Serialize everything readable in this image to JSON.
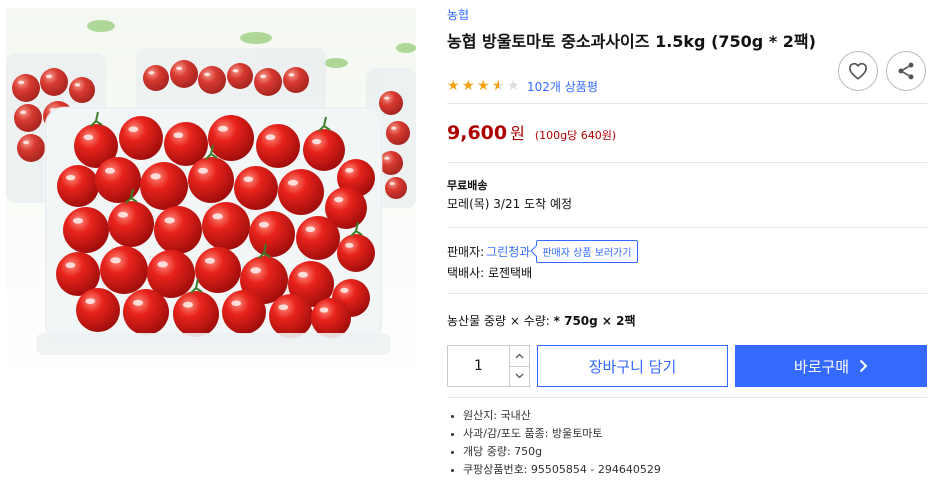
{
  "product": {
    "brand": "농협",
    "title": "농협 방울토마토 중소과사이즈 1.5kg (750g * 2팩)",
    "rating": 3.5,
    "review_count": "102개 상품평",
    "image_icon": "cherry-tomatoes-photo"
  },
  "price": {
    "amount": "9,600",
    "currency": "원",
    "unit_price": "(100g당 640원)"
  },
  "shipping": {
    "type": "무료배송",
    "arrival": "모레(목) 3/21 도착 예정"
  },
  "seller": {
    "label": "판매자:",
    "name": "그린청과",
    "more_button": "판매자 상품 보러가기",
    "courier": "택배사: 로젠택배"
  },
  "option": {
    "label": "농산물 중량 × 수량:",
    "value": "* 750g × 2팩"
  },
  "purchase": {
    "quantity": "1",
    "cart_label": "장바구니 담기",
    "buy_label": "바로구매"
  },
  "attributes": [
    "원산지: 국내산",
    "사과/감/포도 품종: 방울토마토",
    "개당 중량: 750g",
    "쿠팡상품번호: 95505854 - 294640529"
  ],
  "icons": {
    "wishlist": "heart-icon",
    "share": "share-icon",
    "buy_arrow": "chevron-right-icon",
    "qty_up": "chevron-up-icon",
    "qty_down": "chevron-down-icon"
  },
  "colors": {
    "link": "#346aff",
    "price": "#ae0000",
    "star": "#f6a315",
    "buy_button": "#346aff"
  }
}
